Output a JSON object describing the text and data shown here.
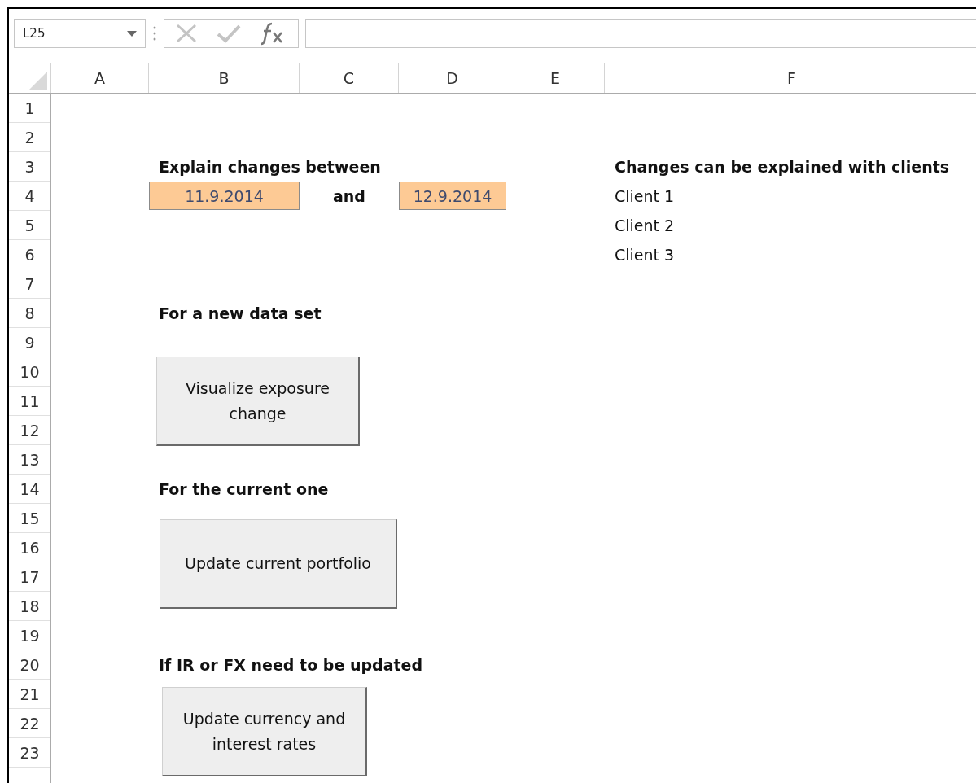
{
  "formula_bar": {
    "name_box": "L25"
  },
  "columns": [
    "A",
    "B",
    "C",
    "D",
    "E",
    "F"
  ],
  "rows": [
    {
      "number": "1"
    },
    {
      "number": "2"
    },
    {
      "number": "3",
      "cells": [
        null,
        {
          "text": "Explain changes between",
          "kind": "bold"
        },
        null,
        null,
        null,
        {
          "text": "Changes can be explained with clients",
          "kind": "bold"
        }
      ]
    },
    {
      "number": "4",
      "cells": [
        null,
        {
          "text": "11.9.2014",
          "kind": "date"
        },
        {
          "text": "and",
          "kind": "bold-center"
        },
        {
          "text": "12.9.2014",
          "kind": "date"
        },
        null,
        {
          "text": "Client 1",
          "kind": "plain"
        }
      ]
    },
    {
      "number": "5",
      "cells": [
        null,
        null,
        null,
        null,
        null,
        {
          "text": "Client 2",
          "kind": "plain"
        }
      ]
    },
    {
      "number": "6",
      "cells": [
        null,
        null,
        null,
        null,
        null,
        {
          "text": "Client 3",
          "kind": "plain"
        }
      ]
    },
    {
      "number": "7"
    },
    {
      "number": "8",
      "cells": [
        null,
        {
          "text": "For a new data set",
          "kind": "bold"
        }
      ]
    },
    {
      "number": "9"
    },
    {
      "number": "10"
    },
    {
      "number": "11"
    },
    {
      "number": "12"
    },
    {
      "number": "13"
    },
    {
      "number": "14",
      "cells": [
        null,
        {
          "text": "For the current one",
          "kind": "bold"
        }
      ]
    },
    {
      "number": "15"
    },
    {
      "number": "16"
    },
    {
      "number": "17"
    },
    {
      "number": "18"
    },
    {
      "number": "19"
    },
    {
      "number": "20",
      "cells": [
        null,
        {
          "text": "If IR or FX need to be updated",
          "kind": "bold"
        }
      ]
    },
    {
      "number": "21"
    },
    {
      "number": "22"
    },
    {
      "number": "23"
    }
  ],
  "buttons": [
    {
      "label": "Visualize exposure change"
    },
    {
      "label": "Update current portfolio"
    },
    {
      "label": "Update currency and interest rates"
    }
  ]
}
